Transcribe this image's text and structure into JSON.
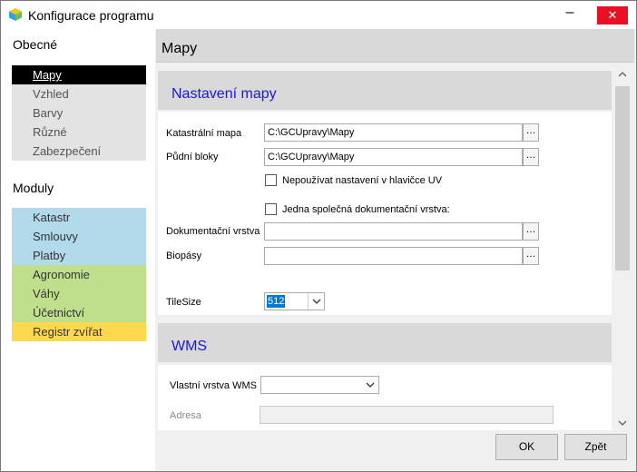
{
  "window": {
    "title": "Konfigurace programu"
  },
  "sidebar": {
    "general_title": "Obecné",
    "general_items": [
      {
        "label": "Mapy"
      },
      {
        "label": "Vzhled"
      },
      {
        "label": "Barvy"
      },
      {
        "label": "Různé"
      },
      {
        "label": "Zabezpečení"
      }
    ],
    "modules_title": "Moduly",
    "module_items": [
      {
        "label": "Katastr",
        "color": "#b2daea"
      },
      {
        "label": "Smlouvy",
        "color": "#b2daea"
      },
      {
        "label": "Platby",
        "color": "#b2daea"
      },
      {
        "label": "Agronomie",
        "color": "#bfdf8c"
      },
      {
        "label": "Váhy",
        "color": "#bfdf8c"
      },
      {
        "label": "Účetnictví",
        "color": "#bfdf8c"
      },
      {
        "label": "Registr zvířat",
        "color": "#ffd94d"
      }
    ]
  },
  "main": {
    "title": "Mapy",
    "map_settings": {
      "header": "Nastavení mapy",
      "cadastral_label": "Katastrální mapa",
      "cadastral_value": "C:\\GCUpravy\\Mapy",
      "soil_label": "Půdní bloky",
      "soil_value": "C:\\GCUpravy\\Mapy",
      "browse_label": "…",
      "no_header_uv_label": "Nepoužívat nastavení v hlavičce UV",
      "single_doc_layer_label": "Jedna společná dokumentační vrstva:",
      "doc_layer_label": "Dokumentační vrstva",
      "doc_layer_value": "",
      "biobelts_label": "Biopásy",
      "biobelts_value": "",
      "tilesize_label": "TileSize",
      "tilesize_value": "512"
    },
    "wms": {
      "header": "WMS",
      "own_layer_label": "Vlastní vrstva WMS",
      "own_layer_value": "",
      "address_label": "Adresa",
      "address_value": ""
    }
  },
  "footer": {
    "ok_label": "OK",
    "back_label": "Zpět"
  },
  "colors": {
    "accent_header_text": "#1a1ad0",
    "close_button": "#e81123",
    "selection": "#0078d7"
  }
}
